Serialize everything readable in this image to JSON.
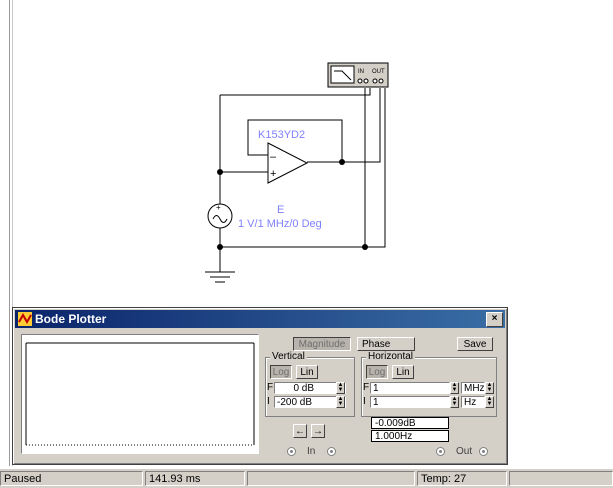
{
  "schematic": {
    "opamp_label": "K153YD2",
    "source_name": "E",
    "source_value": "1 V/1 MHz/0 Deg",
    "instrument_in_label": "IN",
    "instrument_out_label": "OUT"
  },
  "bode": {
    "title": "Bode Plotter",
    "close_label": "×",
    "modes": {
      "magnitude": "Magnitude",
      "phase": "Phase",
      "active": "Magnitude"
    },
    "save_label": "Save",
    "vertical": {
      "label": "Vertical",
      "log_label": "Log",
      "lin_label": "Lin",
      "active": "Log",
      "f_label": "F",
      "f_value": "0",
      "f_unit": "dB",
      "i_label": "I",
      "i_value": "-200",
      "i_unit": "dB"
    },
    "horizontal": {
      "label": "Horizontal",
      "log_label": "Log",
      "lin_label": "Lin",
      "active": "Log",
      "f_label": "F",
      "f_value": "1",
      "f_unit": "MHz",
      "i_label": "I",
      "i_value": "1",
      "i_unit": "Hz"
    },
    "cursor_left": "←",
    "cursor_right": "→",
    "readout_db": "-0.009dB",
    "readout_hz": "1.000Hz",
    "in_label": "In",
    "out_label": "Out"
  },
  "status": {
    "state": "Paused",
    "time": "141.93 ms",
    "temp": "Temp: 27"
  },
  "colors": {
    "wire": "#000000",
    "component_label": "#8080ff",
    "titlebar_start": "#0a246a",
    "titlebar_end": "#3a6ea5",
    "face": "#d4d0c8"
  }
}
